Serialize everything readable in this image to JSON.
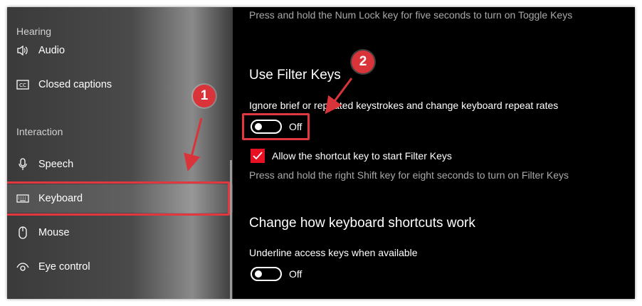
{
  "sidebar": {
    "section_hearing": "Hearing",
    "section_interaction": "Interaction",
    "items": [
      {
        "label": "Audio",
        "icon": "speaker-icon"
      },
      {
        "label": "Closed captions",
        "icon": "cc-icon"
      },
      {
        "label": "Speech",
        "icon": "microphone-icon"
      },
      {
        "label": "Keyboard",
        "icon": "keyboard-icon",
        "selected": true
      },
      {
        "label": "Mouse",
        "icon": "mouse-icon"
      },
      {
        "label": "Eye control",
        "icon": "eye-icon"
      }
    ]
  },
  "main": {
    "toggle_keys_desc": "Press and hold the Num Lock key for five seconds to turn on Toggle Keys",
    "filter_keys_heading": "Use Filter Keys",
    "filter_keys_desc": "Ignore brief or repeated keystrokes and change keyboard repeat rates",
    "filter_keys_toggle_state": "Off",
    "shortcut_checkbox_label": "Allow the shortcut key to start Filter Keys",
    "shortcut_checkbox_checked": true,
    "shortcut_desc": "Press and hold the right Shift key for eight seconds to turn on Filter Keys",
    "shortcuts_heading": "Change how keyboard shortcuts work",
    "underline_desc": "Underline access keys when available",
    "underline_toggle_state": "Off"
  },
  "annotations": {
    "step1": "1",
    "step2": "2"
  },
  "colors": {
    "accent": "#e81123",
    "annotation": "#d8343a",
    "content_bg": "#000000"
  }
}
